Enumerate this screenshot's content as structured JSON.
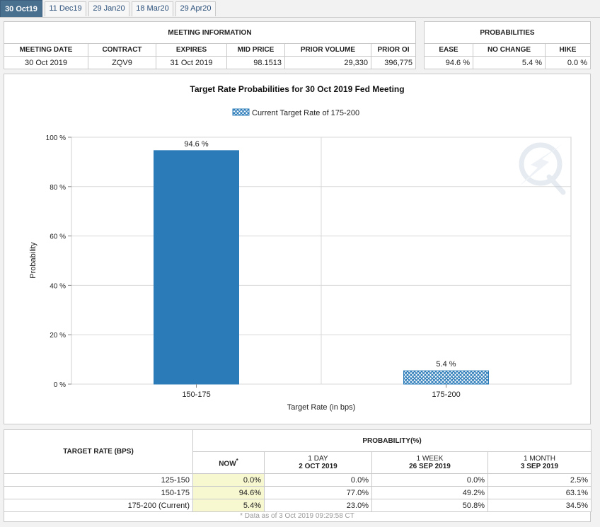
{
  "tabs": [
    "30 Oct19",
    "11 Dec19",
    "29 Jan20",
    "18 Mar20",
    "29 Apr20"
  ],
  "meeting_info": {
    "title": "MEETING INFORMATION",
    "headers": [
      "MEETING DATE",
      "CONTRACT",
      "EXPIRES",
      "MID PRICE",
      "PRIOR VOLUME",
      "PRIOR OI"
    ],
    "row": [
      "30 Oct 2019",
      "ZQV9",
      "31 Oct 2019",
      "98.1513",
      "29,330",
      "396,775"
    ]
  },
  "probabilities": {
    "title": "PROBABILITIES",
    "headers": [
      "EASE",
      "NO CHANGE",
      "HIKE"
    ],
    "row": [
      "94.6 %",
      "5.4 %",
      "0.0 %"
    ]
  },
  "chart_data": {
    "type": "bar",
    "title": "Target Rate Probabilities for 30 Oct 2019 Fed Meeting",
    "legend": "Current Target Rate of 175-200",
    "xlabel": "Target Rate (in bps)",
    "ylabel": "Probability",
    "categories": [
      "150-175",
      "175-200"
    ],
    "values": [
      94.6,
      5.4
    ],
    "data_labels": [
      "94.6 %",
      "5.4 %"
    ],
    "ylim": [
      0,
      100
    ],
    "yticks": [
      "0 %",
      "20 %",
      "40 %",
      "60 %",
      "80 %",
      "100 %"
    ],
    "current_category": "175-200",
    "bar_color": "#2b7bb9",
    "grid": true
  },
  "history": {
    "target_rate_header": "TARGET RATE (BPS)",
    "probability_header": "PROBABILITY(%)",
    "col_now": "NOW",
    "col_now_mark": "*",
    "col_1day": "1 DAY",
    "col_1day_date": "2 OCT 2019",
    "col_1week": "1 WEEK",
    "col_1week_date": "26 SEP 2019",
    "col_1month": "1 MONTH",
    "col_1month_date": "3 SEP 2019",
    "rows": [
      {
        "rate": "125-150",
        "now": "0.0%",
        "d1": "0.0%",
        "w1": "0.0%",
        "m1": "2.5%"
      },
      {
        "rate": "150-175",
        "now": "94.6%",
        "d1": "77.0%",
        "w1": "49.2%",
        "m1": "63.1%"
      },
      {
        "rate": "175-200 (Current)",
        "now": "5.4%",
        "d1": "23.0%",
        "w1": "50.8%",
        "m1": "34.5%"
      }
    ],
    "footnote": "* Data as of 3 Oct 2019 09:29:58 CT"
  }
}
